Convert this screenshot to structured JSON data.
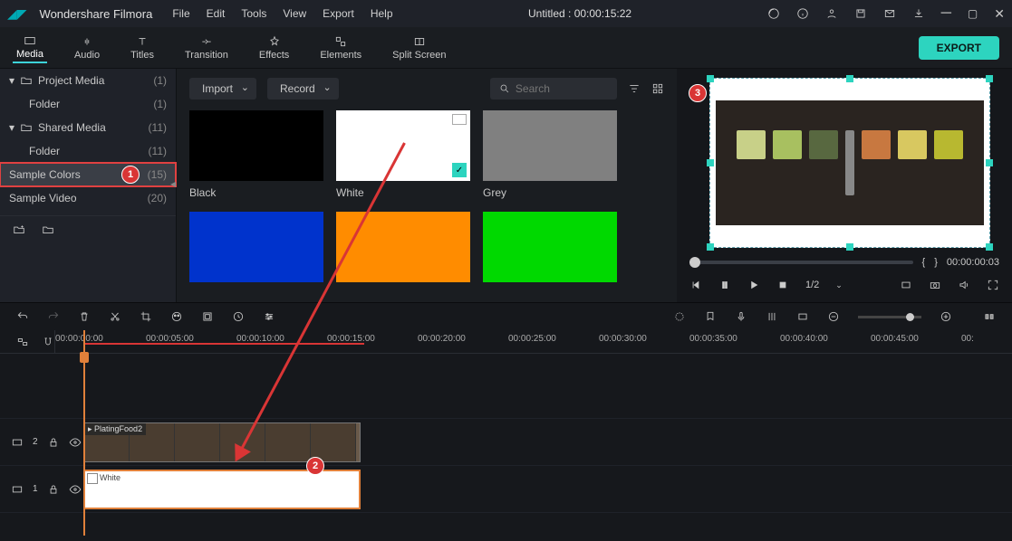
{
  "app": {
    "name": "Wondershare Filmora",
    "title": "Untitled : 00:00:15:22"
  },
  "menu": [
    "File",
    "Edit",
    "Tools",
    "View",
    "Export",
    "Help"
  ],
  "tabs": [
    {
      "label": "Media",
      "active": true
    },
    {
      "label": "Audio"
    },
    {
      "label": "Titles"
    },
    {
      "label": "Transition"
    },
    {
      "label": "Effects"
    },
    {
      "label": "Elements"
    },
    {
      "label": "Split Screen"
    }
  ],
  "export_label": "EXPORT",
  "sidebar": [
    {
      "label": "Project Media",
      "count": "(1)",
      "expandable": true,
      "open": true
    },
    {
      "label": "Folder",
      "count": "(1)",
      "sub": true
    },
    {
      "label": "Shared Media",
      "count": "(11)",
      "expandable": true,
      "open": true
    },
    {
      "label": "Folder",
      "count": "(11)",
      "sub": true
    },
    {
      "label": "Sample Colors",
      "count": "(15)",
      "highlighted": true,
      "redbox": true,
      "badge": "1"
    },
    {
      "label": "Sample Video",
      "count": "(20)"
    }
  ],
  "content_toolbar": {
    "import": "Import",
    "record": "Record",
    "search_placeholder": "Search"
  },
  "swatches": [
    {
      "label": "Black",
      "color": "#000000"
    },
    {
      "label": "White",
      "color": "#ffffff",
      "checked": true,
      "img": true
    },
    {
      "label": "Grey",
      "color": "#808080"
    },
    {
      "label": "",
      "color": "#0033cc"
    },
    {
      "label": "",
      "color": "#ff8c00"
    },
    {
      "label": "",
      "color": "#00d900"
    }
  ],
  "preview": {
    "time_current": "{",
    "time_sep": "}",
    "time_total": "00:00:00:03",
    "ratio": "1/2",
    "badge": "3"
  },
  "timeline": {
    "ticks": [
      "00:00:00:00",
      "00:00:05:00",
      "00:00:10:00",
      "00:00:15:00",
      "00:00:20:00",
      "00:00:25:00",
      "00:00:30:00",
      "00:00:35:00",
      "00:00:40:00",
      "00:00:45:00",
      "00:"
    ],
    "tracks": [
      {
        "num": "2",
        "clip": {
          "type": "video",
          "label": "PlatingFood2"
        }
      },
      {
        "num": "1",
        "clip": {
          "type": "white",
          "label": "White",
          "badge": "2"
        }
      }
    ]
  }
}
